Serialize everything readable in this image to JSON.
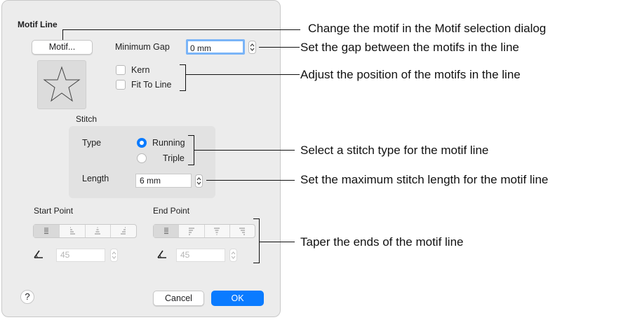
{
  "dialog": {
    "section_title": "Motif Line",
    "motif_button": "Motif...",
    "min_gap_label": "Minimum Gap",
    "min_gap_value": "0 mm",
    "kern_label": "Kern",
    "fit_to_line_label": "Fit To Line",
    "stitch_label": "Stitch",
    "type_label": "Type",
    "type_options": [
      "Running",
      "Triple"
    ],
    "type_selected": "Running",
    "length_label": "Length",
    "length_value": "6 mm",
    "start_point_label": "Start Point",
    "end_point_label": "End Point",
    "start_angle_value": "45",
    "end_angle_value": "45",
    "help_label": "?",
    "cancel_label": "Cancel",
    "ok_label": "OK",
    "accent_color": "#0a7bff",
    "preview_icon": "star-outline-icon"
  },
  "callouts": {
    "motif": "Change the motif in the Motif selection dialog",
    "gap": "Set the gap between the motifs in the line",
    "position": "Adjust the position of the motifs in the line",
    "stitch_type": "Select a stitch type for the motif line",
    "max_length": "Set the maximum stitch length for the motif line",
    "taper": "Taper the ends of the motif line"
  }
}
